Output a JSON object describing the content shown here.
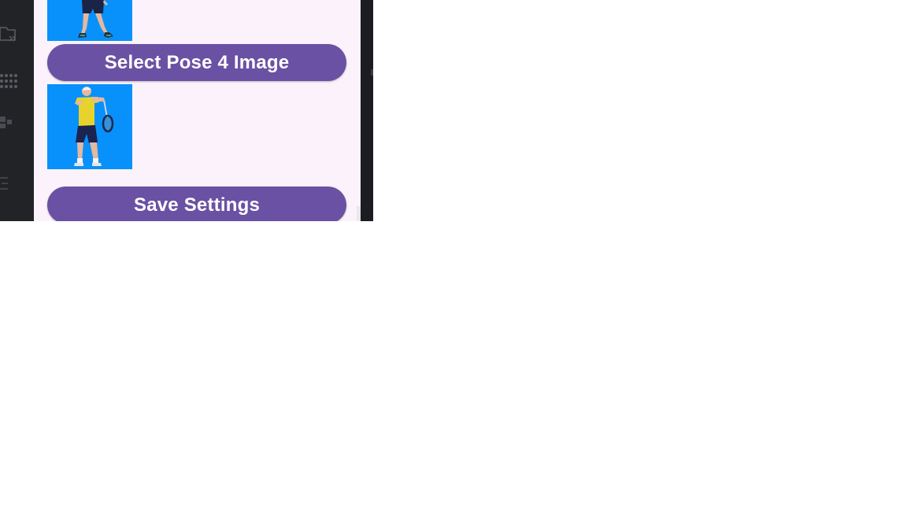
{
  "buttons": {
    "select_pose_4": "Select Pose 4 Image",
    "save_settings": "Save Settings"
  },
  "images": {
    "pose_3": "pose 3 image",
    "pose_4": "pose 4 image"
  },
  "sidebar": {
    "icons": [
      "folder-arrows-icon",
      "dots-grid-icon",
      "emulator-icon",
      "collapse-icon"
    ]
  },
  "colors": {
    "app_background": "#fbf2fb",
    "button": "#6a51a4",
    "button_text": "#ffffff",
    "thumb_background": "#0891fb",
    "editor_background": "#26272a"
  }
}
